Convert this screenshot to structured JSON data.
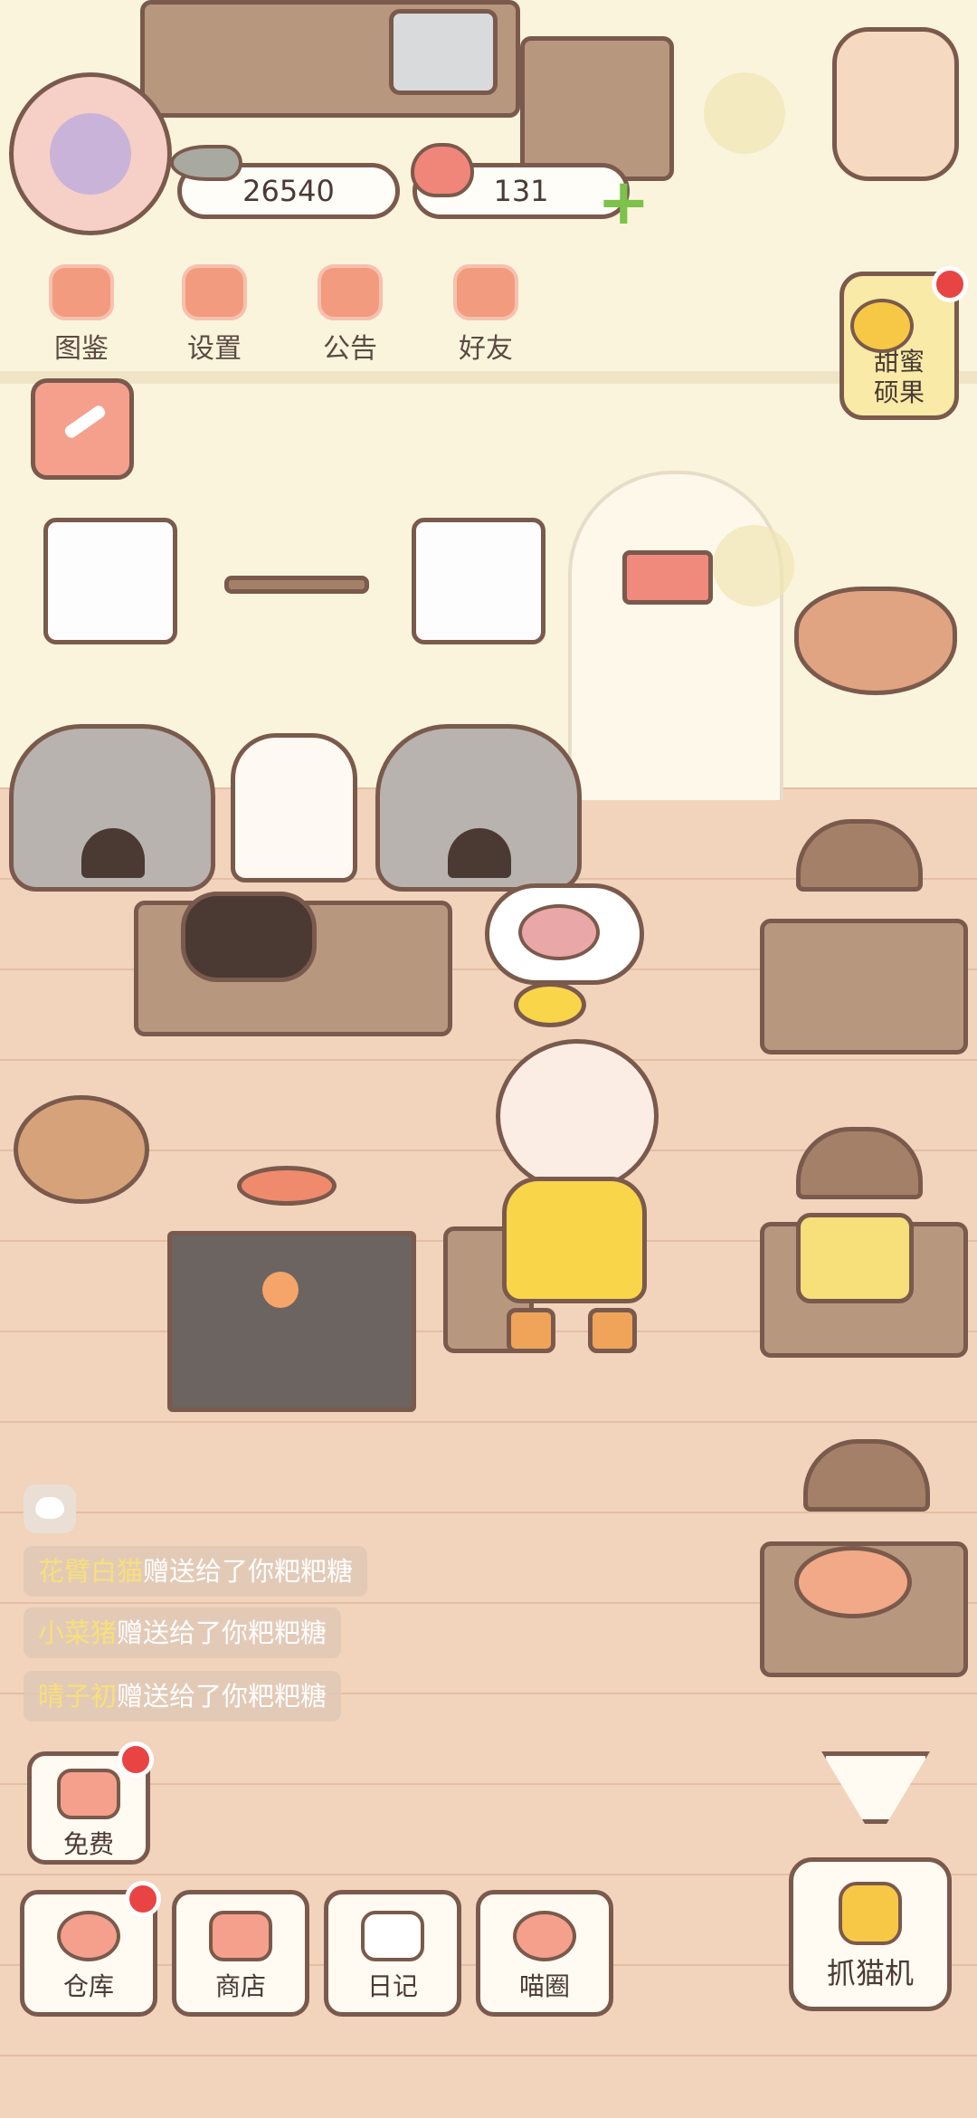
{
  "resources": {
    "fish_count": "26540",
    "heart_count": "131"
  },
  "top_menu": [
    {
      "label": "图鉴",
      "icon": "cat-book-icon"
    },
    {
      "label": "设置",
      "icon": "gear-icon"
    },
    {
      "label": "公告",
      "icon": "gift-icon"
    },
    {
      "label": "好友",
      "icon": "friends-icon"
    }
  ],
  "sweet_fruit": {
    "label_line1": "甜蜜",
    "label_line2": "硕果"
  },
  "chat_messages": [
    {
      "name": "花臂白猫",
      "text": "赠送给了你粑粑糖"
    },
    {
      "name": "小菜猪",
      "text": "赠送给了你粑粑糖"
    },
    {
      "name": "晴子初",
      "text": "赠送给了你粑粑糖"
    }
  ],
  "bottom_buttons": {
    "free": "免费",
    "warehouse": "仓库",
    "shop": "商店",
    "diary": "日记",
    "cat_circle": "喵圈",
    "claw_machine": "抓猫机"
  },
  "colors": {
    "wall": "#fbf4dc",
    "floor": "#f2d3bc",
    "outline": "#7a5a4c",
    "accent_red": "#e84444",
    "coral": "#f4a08d",
    "yellow": "#f9d54a"
  }
}
